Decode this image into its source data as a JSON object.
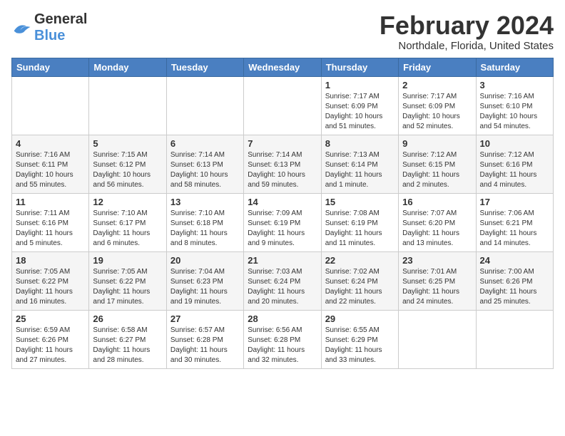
{
  "logo": {
    "line1": "General",
    "line2": "Blue"
  },
  "header": {
    "month": "February 2024",
    "location": "Northdale, Florida, United States"
  },
  "weekdays": [
    "Sunday",
    "Monday",
    "Tuesday",
    "Wednesday",
    "Thursday",
    "Friday",
    "Saturday"
  ],
  "weeks": [
    [
      {
        "day": "",
        "content": ""
      },
      {
        "day": "",
        "content": ""
      },
      {
        "day": "",
        "content": ""
      },
      {
        "day": "",
        "content": ""
      },
      {
        "day": "1",
        "content": "Sunrise: 7:17 AM\nSunset: 6:09 PM\nDaylight: 10 hours\nand 51 minutes."
      },
      {
        "day": "2",
        "content": "Sunrise: 7:17 AM\nSunset: 6:09 PM\nDaylight: 10 hours\nand 52 minutes."
      },
      {
        "day": "3",
        "content": "Sunrise: 7:16 AM\nSunset: 6:10 PM\nDaylight: 10 hours\nand 54 minutes."
      }
    ],
    [
      {
        "day": "4",
        "content": "Sunrise: 7:16 AM\nSunset: 6:11 PM\nDaylight: 10 hours\nand 55 minutes."
      },
      {
        "day": "5",
        "content": "Sunrise: 7:15 AM\nSunset: 6:12 PM\nDaylight: 10 hours\nand 56 minutes."
      },
      {
        "day": "6",
        "content": "Sunrise: 7:14 AM\nSunset: 6:13 PM\nDaylight: 10 hours\nand 58 minutes."
      },
      {
        "day": "7",
        "content": "Sunrise: 7:14 AM\nSunset: 6:13 PM\nDaylight: 10 hours\nand 59 minutes."
      },
      {
        "day": "8",
        "content": "Sunrise: 7:13 AM\nSunset: 6:14 PM\nDaylight: 11 hours\nand 1 minute."
      },
      {
        "day": "9",
        "content": "Sunrise: 7:12 AM\nSunset: 6:15 PM\nDaylight: 11 hours\nand 2 minutes."
      },
      {
        "day": "10",
        "content": "Sunrise: 7:12 AM\nSunset: 6:16 PM\nDaylight: 11 hours\nand 4 minutes."
      }
    ],
    [
      {
        "day": "11",
        "content": "Sunrise: 7:11 AM\nSunset: 6:16 PM\nDaylight: 11 hours\nand 5 minutes."
      },
      {
        "day": "12",
        "content": "Sunrise: 7:10 AM\nSunset: 6:17 PM\nDaylight: 11 hours\nand 6 minutes."
      },
      {
        "day": "13",
        "content": "Sunrise: 7:10 AM\nSunset: 6:18 PM\nDaylight: 11 hours\nand 8 minutes."
      },
      {
        "day": "14",
        "content": "Sunrise: 7:09 AM\nSunset: 6:19 PM\nDaylight: 11 hours\nand 9 minutes."
      },
      {
        "day": "15",
        "content": "Sunrise: 7:08 AM\nSunset: 6:19 PM\nDaylight: 11 hours\nand 11 minutes."
      },
      {
        "day": "16",
        "content": "Sunrise: 7:07 AM\nSunset: 6:20 PM\nDaylight: 11 hours\nand 13 minutes."
      },
      {
        "day": "17",
        "content": "Sunrise: 7:06 AM\nSunset: 6:21 PM\nDaylight: 11 hours\nand 14 minutes."
      }
    ],
    [
      {
        "day": "18",
        "content": "Sunrise: 7:05 AM\nSunset: 6:22 PM\nDaylight: 11 hours\nand 16 minutes."
      },
      {
        "day": "19",
        "content": "Sunrise: 7:05 AM\nSunset: 6:22 PM\nDaylight: 11 hours\nand 17 minutes."
      },
      {
        "day": "20",
        "content": "Sunrise: 7:04 AM\nSunset: 6:23 PM\nDaylight: 11 hours\nand 19 minutes."
      },
      {
        "day": "21",
        "content": "Sunrise: 7:03 AM\nSunset: 6:24 PM\nDaylight: 11 hours\nand 20 minutes."
      },
      {
        "day": "22",
        "content": "Sunrise: 7:02 AM\nSunset: 6:24 PM\nDaylight: 11 hours\nand 22 minutes."
      },
      {
        "day": "23",
        "content": "Sunrise: 7:01 AM\nSunset: 6:25 PM\nDaylight: 11 hours\nand 24 minutes."
      },
      {
        "day": "24",
        "content": "Sunrise: 7:00 AM\nSunset: 6:26 PM\nDaylight: 11 hours\nand 25 minutes."
      }
    ],
    [
      {
        "day": "25",
        "content": "Sunrise: 6:59 AM\nSunset: 6:26 PM\nDaylight: 11 hours\nand 27 minutes."
      },
      {
        "day": "26",
        "content": "Sunrise: 6:58 AM\nSunset: 6:27 PM\nDaylight: 11 hours\nand 28 minutes."
      },
      {
        "day": "27",
        "content": "Sunrise: 6:57 AM\nSunset: 6:28 PM\nDaylight: 11 hours\nand 30 minutes."
      },
      {
        "day": "28",
        "content": "Sunrise: 6:56 AM\nSunset: 6:28 PM\nDaylight: 11 hours\nand 32 minutes."
      },
      {
        "day": "29",
        "content": "Sunrise: 6:55 AM\nSunset: 6:29 PM\nDaylight: 11 hours\nand 33 minutes."
      },
      {
        "day": "",
        "content": ""
      },
      {
        "day": "",
        "content": ""
      }
    ]
  ]
}
